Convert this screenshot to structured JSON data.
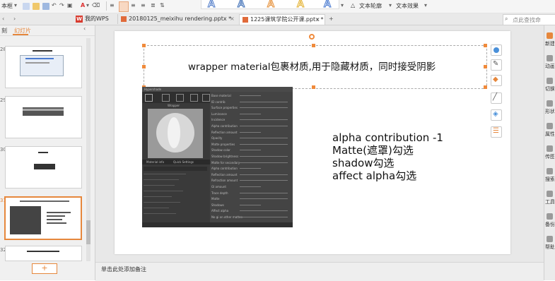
{
  "toolbar": {
    "left_label": "本框",
    "wordart_glyph": "A",
    "text_outline": "文本轮廓",
    "text_effect": "文本效果"
  },
  "tabs": [
    {
      "label": "我的WPS"
    },
    {
      "label": "20180125_meixihu rendering.pptx *"
    },
    {
      "label": "1225课筑学院公开课.pptx *"
    }
  ],
  "search_placeholder": "点此查找命",
  "left_panel": {
    "tab1": "刻",
    "tab2": "幻灯片",
    "slide_numbers": [
      "28",
      "29",
      "30",
      "31",
      "32"
    ],
    "add_button": "+"
  },
  "slide": {
    "title": "wrapper material包裹材质,用于隐藏材质，同时接受阴影",
    "notes": [
      "alpha contribution -1",
      "Matte(遮罩)勾选",
      "shadow勾选",
      "affect alpha勾选"
    ]
  },
  "status_bar": {
    "notes_placeholder": "单击此处添加备注"
  },
  "right_panel": {
    "items": [
      "新建",
      "动画",
      "切换",
      "形状",
      "属性",
      "传图",
      "搜索",
      "工具",
      "备份",
      "帮助"
    ]
  },
  "embedded_window": {
    "title": "Hypershade",
    "panel_label": "Wrapper",
    "tab_a": "Material info",
    "tab_b": "Quick Settings",
    "attrs": [
      "Base material",
      "ID contrib",
      "Surface properties",
      "Luminance",
      "Incidence",
      "Alpha contribution",
      "Reflection amount",
      "Opacity",
      "Matte properties",
      "Shadow color",
      "Shadow brightness",
      "Matte for secondary",
      "Alpha contribution",
      "Reflection amount",
      "Refraction amount",
      "GI amount",
      "Trace depth",
      "Matte",
      "Shadows",
      "Affect alpha",
      "No gi on other mattes"
    ]
  },
  "colors": {
    "accent": "#e6873c",
    "handle": "#f08a3b",
    "wps_red": "#d83b2f"
  }
}
